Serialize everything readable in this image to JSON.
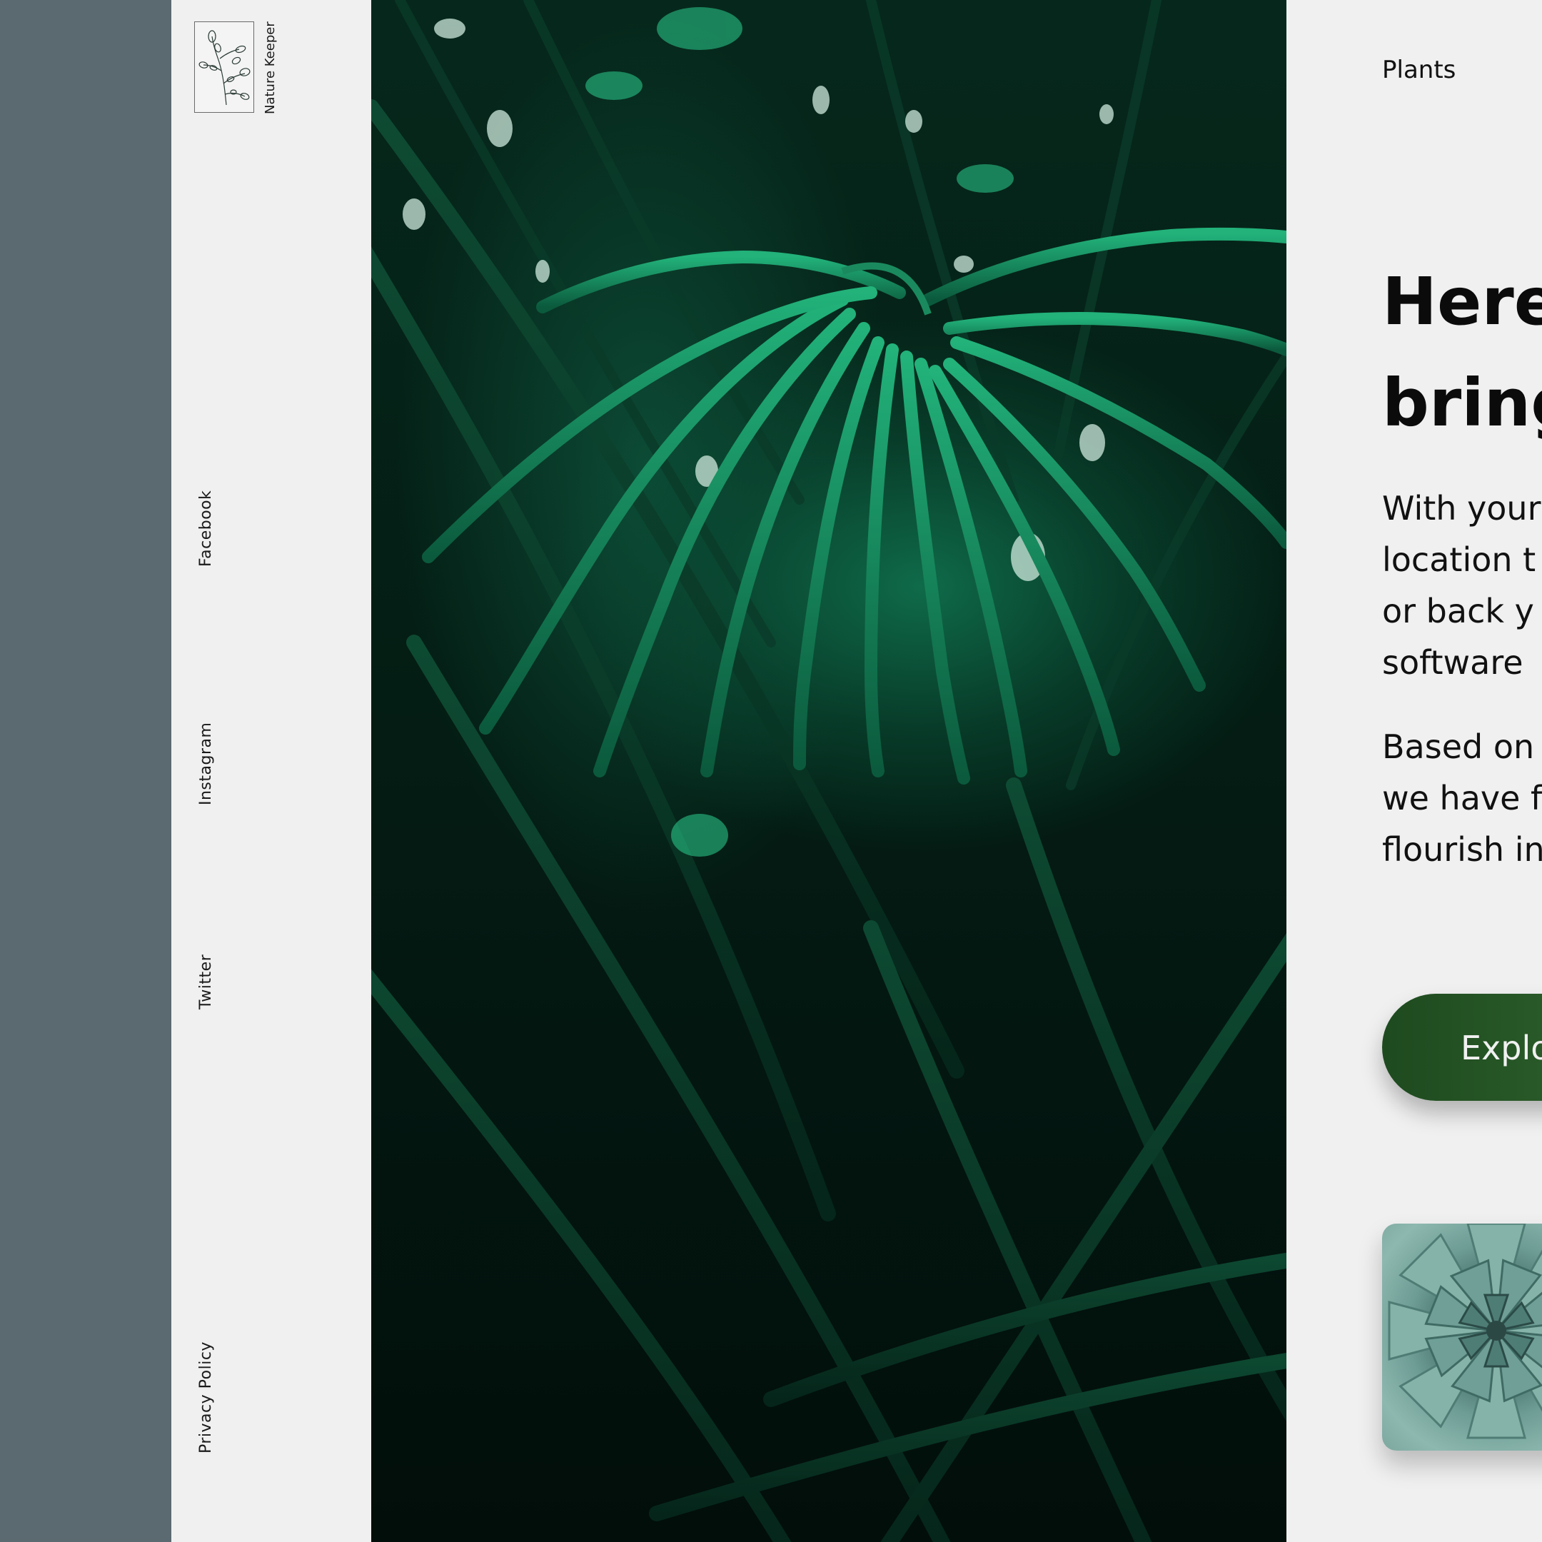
{
  "brand": {
    "name": "Nature Keeper",
    "logo_icon": "plant-sketch-icon"
  },
  "social_links": [
    {
      "label": "Facebook"
    },
    {
      "label": "Instagram"
    },
    {
      "label": "Twitter"
    }
  ],
  "footer_link": "Privacy Policy",
  "nav": {
    "plants": "Plants"
  },
  "hero": {
    "headline_line1": "Here",
    "headline_line2": "bring",
    "paragraph1": [
      "With your",
      "location t",
      "or back y",
      "software "
    ],
    "paragraph2": [
      "Based on",
      "we have f",
      "flourish in"
    ],
    "cta_label": "Explo"
  },
  "colors": {
    "slate": "#5b6970",
    "panel": "#f0f0f0",
    "cta_green": "#2d5f2b"
  }
}
